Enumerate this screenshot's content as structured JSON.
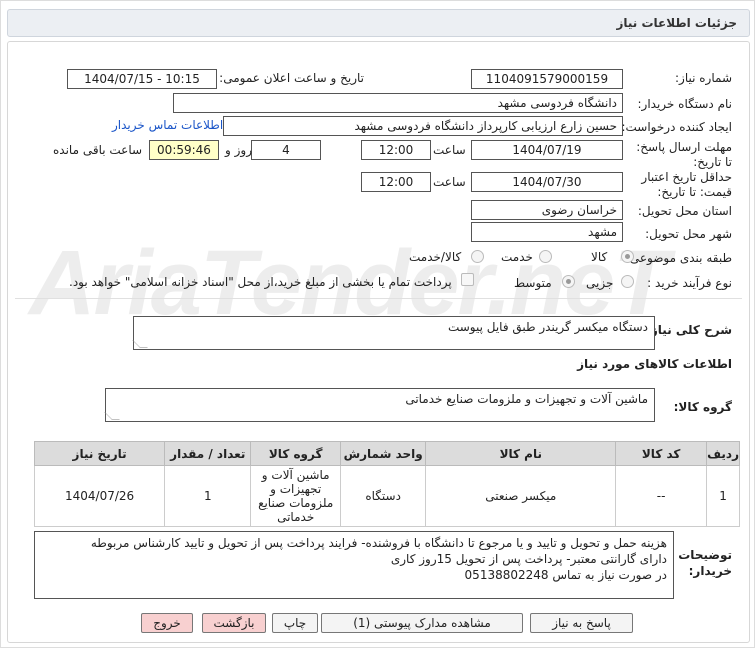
{
  "header": {
    "title": "جزئیات اطلاعات نیاز"
  },
  "fields": {
    "need_number_label": "شماره نیاز:",
    "need_number": "1104091579000159",
    "announce_label": "تاریخ و ساعت اعلان عمومی:",
    "announce_value": "1404/07/15 - 10:15",
    "buyer_label": "نام دستگاه خریدار:",
    "buyer": "دانشگاه فردوسی مشهد",
    "creator_label": "ایجاد کننده درخواست:",
    "creator": "حسین زارع ارزیابی کارپرداز دانشگاه فردوسی مشهد",
    "contact_link": "اطلاعات تماس خریدار",
    "reply_deadline_label": "مهلت ارسال پاسخ: تا تاریخ:",
    "reply_date": "1404/07/19",
    "time_label": "ساعت",
    "reply_time": "12:00",
    "days": "4",
    "days_label": "روز و",
    "remaining": "00:59:46",
    "remaining_label": "ساعت باقی مانده",
    "price_validity_label": "حداقل تاریخ اعتبار قیمت: تا تاریخ:",
    "validity_date": "1404/07/30",
    "validity_time": "12:00",
    "province_label": "استان محل تحویل:",
    "province": "خراسان رضوی",
    "city_label": "شهر محل تحویل:",
    "city": "مشهد",
    "category_label": "طبقه بندی موضوعی:",
    "category_options": [
      "کالا",
      "خدمت",
      "کالا/خدمت"
    ],
    "process_label": "نوع فرآیند خرید :",
    "process_options": [
      "جزیی",
      "متوسط"
    ],
    "treasury_text": "پرداخت تمام یا بخشی از مبلغ خرید،از محل \"اسناد خزانه اسلامی\" خواهد بود."
  },
  "summary": {
    "label": "شرح کلی نیاز:",
    "value": "دستگاه میکسر گریندر طبق فایل پیوست"
  },
  "goods_info": {
    "title": "اطلاعات کالاهای مورد نیاز"
  },
  "goods_group": {
    "label": "گروه کالا:",
    "value": "ماشین آلات و تجهیزات و ملزومات صنایع خدماتی"
  },
  "table": {
    "headers": [
      "ردیف",
      "کد کالا",
      "نام کالا",
      "واحد شمارش",
      "گروه کالا",
      "تعداد / مقدار",
      "تاریخ نیاز"
    ],
    "rows": [
      [
        "1",
        "--",
        "میکسر صنعتی",
        "دستگاه",
        "ماشین آلات و تجهیزات و ملزومات صنایع خدماتی",
        "1",
        "1404/07/26"
      ]
    ]
  },
  "notes": {
    "label": "توضیحات خریدار:",
    "lines": [
      "هزینه حمل و تحویل و تایید و یا مرجوع تا دانشگاه با فروشنده- فرایند پرداخت پس از تحویل و تایید کارشناس مربوطه",
      "دارای گارانتی معتبر- پرداخت پس از تحویل 15روز کاری",
      "در صورت نیاز به تماس 05138802248"
    ]
  },
  "buttons": {
    "reply": "پاسخ به نیاز",
    "attachments": "مشاهده مدارک پیوستی (1)",
    "print": "چاپ",
    "back": "بازگشت",
    "exit": "خروج"
  }
}
